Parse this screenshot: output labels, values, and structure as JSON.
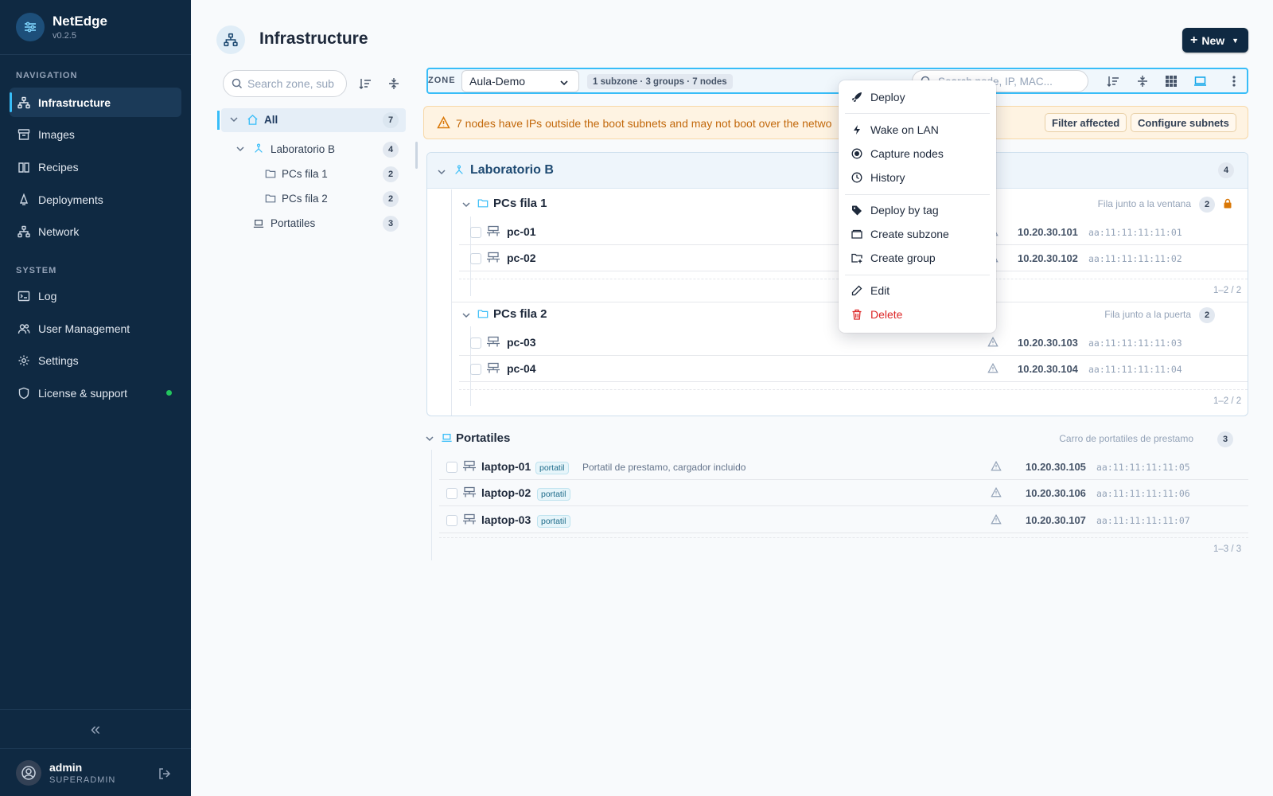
{
  "brand": {
    "name": "NetEdge",
    "version": "v0.2.5"
  },
  "nav": {
    "section_navigation": "NAVIGATION",
    "section_system": "SYSTEM",
    "items": [
      {
        "label": "Infrastructure",
        "icon": "network-icon",
        "active": true
      },
      {
        "label": "Images",
        "icon": "archive-icon"
      },
      {
        "label": "Recipes",
        "icon": "book-icon"
      },
      {
        "label": "Deployments",
        "icon": "rocket-icon"
      },
      {
        "label": "Network",
        "icon": "network-icon"
      },
      {
        "label": "Log",
        "icon": "terminal-icon"
      },
      {
        "label": "User Management",
        "icon": "users-icon"
      },
      {
        "label": "Settings",
        "icon": "gear-icon"
      },
      {
        "label": "License & support",
        "icon": "shield-icon",
        "status_color": "#22c55e"
      }
    ],
    "collapse_icon": "«"
  },
  "user": {
    "name": "admin",
    "role": "SUPERADMIN"
  },
  "header": {
    "title": "Infrastructure",
    "new_button": "New"
  },
  "tree": {
    "search_placeholder": "Search zone, sub",
    "nodes": [
      {
        "label": "All",
        "count": "7"
      },
      {
        "label": "Laboratorio B",
        "count": "4"
      },
      {
        "label": "PCs fila 1",
        "count": "2"
      },
      {
        "label": "PCs fila 2",
        "count": "2"
      },
      {
        "label": "Portatiles",
        "count": "3"
      }
    ]
  },
  "toolbar": {
    "zone_label": "ZONE",
    "zone_value": "Aula-Demo",
    "summary": "1 subzone · 3 groups · 7 nodes",
    "search_placeholder": "Search node, IP, MAC..."
  },
  "warning": {
    "text": "7 nodes have IPs outside the boot subnets and may not boot over the netwo",
    "filter_button": "Filter affected",
    "configure_button": "Configure subnets"
  },
  "zone_card": {
    "title": "Laboratorio B",
    "count": "4",
    "groups": [
      {
        "title": "PCs fila 1",
        "description": "Fila junto a la ventana",
        "count": "2",
        "pager": "1–2 / 2",
        "nodes": [
          {
            "name": "pc-01",
            "ip": "10.20.30.101",
            "mac": "aa:11:11:11:11:01"
          },
          {
            "name": "pc-02",
            "ip": "10.20.30.102",
            "mac": "aa:11:11:11:11:02"
          }
        ]
      },
      {
        "title": "PCs fila 2",
        "description": "Fila junto a la puerta",
        "count": "2",
        "pager": "1–2 / 2",
        "nodes": [
          {
            "name": "pc-03",
            "ip": "10.20.30.103",
            "mac": "aa:11:11:11:11:03"
          },
          {
            "name": "pc-04",
            "ip": "10.20.30.104",
            "mac": "aa:11:11:11:11:04"
          }
        ]
      }
    ]
  },
  "portatiles": {
    "title": "Portatiles",
    "description": "Carro de portatiles de prestamo",
    "count": "3",
    "pager": "1–3 / 3",
    "nodes": [
      {
        "name": "laptop-01",
        "tag": "portatil",
        "note": "Portatil de prestamo, cargador incluido",
        "ip": "10.20.30.105",
        "mac": "aa:11:11:11:11:05"
      },
      {
        "name": "laptop-02",
        "tag": "portatil",
        "ip": "10.20.30.106",
        "mac": "aa:11:11:11:11:06"
      },
      {
        "name": "laptop-03",
        "tag": "portatil",
        "ip": "10.20.30.107",
        "mac": "aa:11:11:11:11:07"
      }
    ]
  },
  "context_menu": {
    "items": [
      {
        "label": "Deploy",
        "icon": "rocket-icon"
      },
      {
        "label": "Wake on LAN",
        "icon": "bolt-icon"
      },
      {
        "label": "Capture nodes",
        "icon": "record-icon"
      },
      {
        "label": "History",
        "icon": "clock-icon"
      },
      {
        "label": "Deploy by tag",
        "icon": "tag-icon"
      },
      {
        "label": "Create subzone",
        "icon": "folder-icon"
      },
      {
        "label": "Create group",
        "icon": "folder-plus-icon"
      },
      {
        "label": "Edit",
        "icon": "pencil-icon"
      },
      {
        "label": "Delete",
        "icon": "trash-icon",
        "color": "#dc2626"
      }
    ]
  },
  "colors": {
    "sidebar": "#0f2942",
    "accent": "#38bdf8",
    "warning": "#c2680b",
    "danger": "#dc2626"
  }
}
